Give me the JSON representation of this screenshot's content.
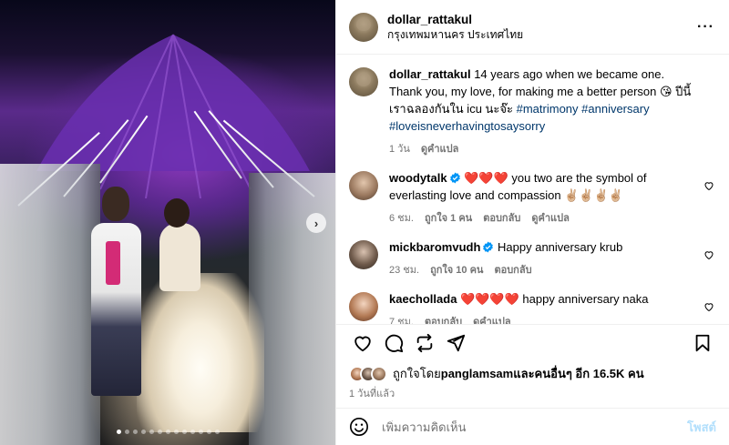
{
  "photo": {
    "carousel_dots": 13,
    "active_dot": 0,
    "next_glyph": "›"
  },
  "post": {
    "owner": "dollar_rattakul",
    "location": "กรุงเทพมหานคร ประเทศไทย",
    "more_icon": "more-horizontal-icon"
  },
  "caption": {
    "username": "dollar_rattakul",
    "text": " 14 years ago when we became one. Thank you, my love, for making me a better person 😘 ปีนี้เราฉลองกันใน icu นะจ๊ะ ",
    "hashtags": "#matrimony #anniversary #loveisneverhavingtosaysorry",
    "time": "1 วัน",
    "translate": "ดูคำแปล"
  },
  "comments": [
    {
      "username": "woodytalk",
      "verified": true,
      "text": " ❤️❤️❤️ you two are the symbol of everlasting love and compassion ✌🏼✌🏼✌🏼✌🏼",
      "time": "6 ชม.",
      "likes": "ถูกใจ 1 คน",
      "reply": "ตอบกลับ",
      "translate": "ดูคำแปล"
    },
    {
      "username": "mickbaromvudh",
      "verified": true,
      "text": " Happy anniversary krub",
      "time": "23 ชม.",
      "likes": "ถูกใจ 10 คน",
      "reply": "ตอบกลับ",
      "translate": ""
    },
    {
      "username": "kaechollada",
      "verified": false,
      "text": " ❤️❤️❤️❤️ happy anniversary naka",
      "time": "7 ชม.",
      "likes": "",
      "reply": "ตอบกลับ",
      "translate": "ดูคำแปล"
    }
  ],
  "likes": {
    "prefix": "ถูกใจโดย ",
    "user": "panglamsam",
    "suffix": " และคนอื่นๆ อีก 16.5K คน"
  },
  "posted_time": "1 วันที่แล้ว",
  "add_comment": {
    "placeholder": "เพิ่มความคิดเห็น",
    "post_label": "โพสต์"
  },
  "colors": {
    "link": "#00376b",
    "meta": "#737373",
    "post_button": "#b2dffc",
    "verified": "#0095f6"
  }
}
